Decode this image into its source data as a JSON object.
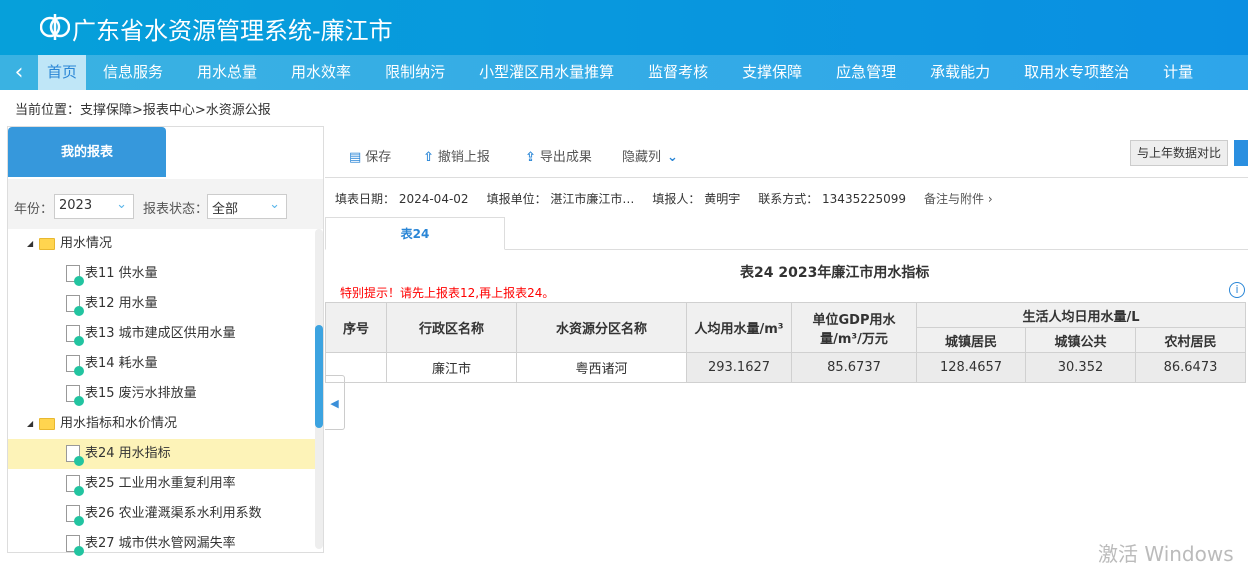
{
  "header": {
    "title": "广东省水资源管理系统-廉江市"
  },
  "nav": {
    "back": "‹",
    "items": [
      "首页",
      "信息服务",
      "用水总量",
      "用水效率",
      "限制纳污",
      "小型灌区用水量推算",
      "监督考核",
      "支撑保障",
      "应急管理",
      "承载能力",
      "取用水专项整治",
      "计量"
    ]
  },
  "breadcrumb": "当前位置：支撑保障>报表中心>水资源公报",
  "left": {
    "tab": "我的报表",
    "year_label": "年份：",
    "year": "2023",
    "status_label": "报表状态：",
    "status": "全部",
    "tree": [
      {
        "type": "folder",
        "label": "用水情况"
      },
      {
        "type": "doc",
        "label": "表11 供水量"
      },
      {
        "type": "doc",
        "label": "表12 用水量"
      },
      {
        "type": "doc",
        "label": "表13 城市建成区供用水量"
      },
      {
        "type": "doc",
        "label": "表14 耗水量"
      },
      {
        "type": "doc",
        "label": "表15 废污水排放量"
      },
      {
        "type": "folder",
        "label": "用水指标和水价情况"
      },
      {
        "type": "doc",
        "label": "表24 用水指标",
        "selected": true
      },
      {
        "type": "doc",
        "label": "表25 工业用水重复利用率"
      },
      {
        "type": "doc",
        "label": "表26 农业灌溉渠系水利用系数"
      },
      {
        "type": "doc",
        "label": "表27 城市供水管网漏失率"
      }
    ]
  },
  "toolbar": {
    "save": "保存",
    "revoke": "撤销上报",
    "export": "导出成果",
    "hide": "隐藏列",
    "compare": "与上年数据对比"
  },
  "info": {
    "date": "填表日期：  2024-04-02",
    "unit": "填报单位：  湛江市廉江市…",
    "person": "填报人：  黄明宇",
    "contact": "联系方式：  13435225099",
    "attach": "备注与附件 ›"
  },
  "tab": "表24",
  "table": {
    "title": "表24 2023年廉江市用水指标",
    "warning": "特别提示！请先上报表12,再上报表24。",
    "headers": {
      "seq": "序号",
      "region": "行政区名称",
      "basin": "水资源分区名称",
      "percap": "人均用水量/m³",
      "gdp": "单位GDP用水量/m³/万元",
      "daily": "生活人均日用水量/L",
      "urban": "城镇居民",
      "public": "城镇公共",
      "rural": "农村居民"
    },
    "row": {
      "seq": "",
      "region": "廉江市",
      "basin": "粤西诸河",
      "percap": "293.1627",
      "gdp": "85.6737",
      "urban": "128.4657",
      "public": "30.352",
      "rural": "86.6473"
    }
  },
  "watermark": "激活 Windows"
}
